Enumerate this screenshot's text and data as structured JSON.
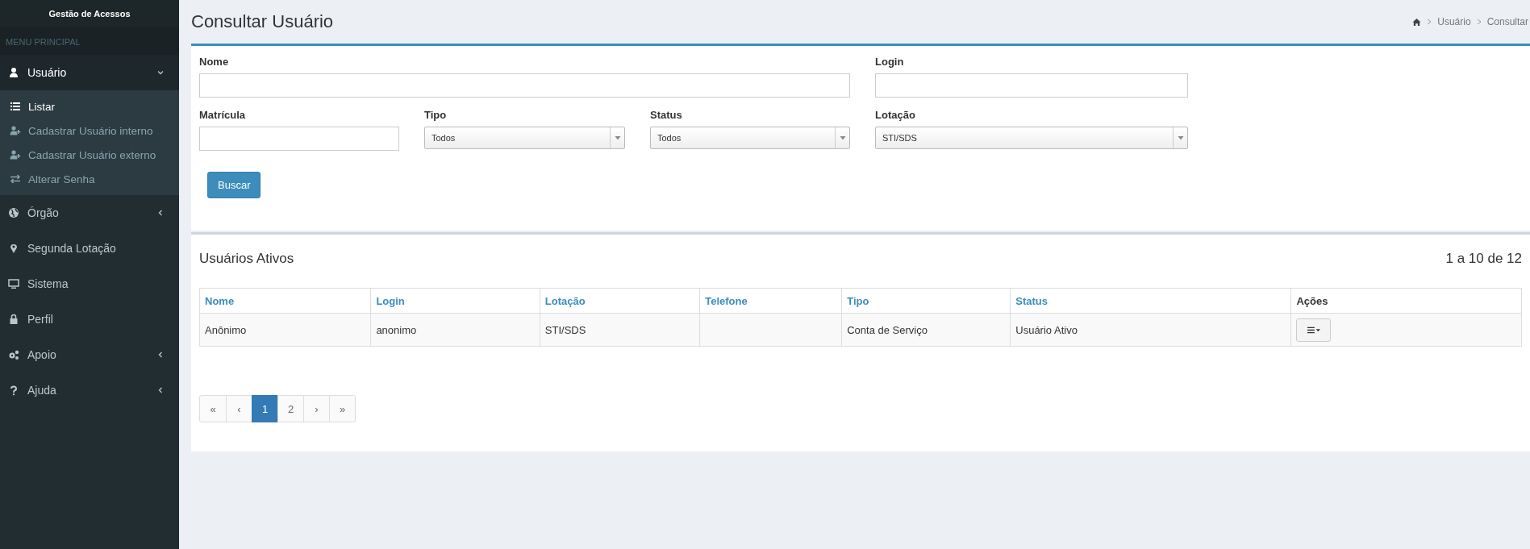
{
  "sidebar": {
    "title": "Gestão de Acessos",
    "section": "MENU PRINCIPAL",
    "items": [
      {
        "label": "Usuário",
        "expanded": true,
        "children": [
          {
            "label": "Listar",
            "selected": true
          },
          {
            "label": "Cadastrar Usuário interno",
            "selected": false
          },
          {
            "label": "Cadastrar Usuário externo",
            "selected": false
          },
          {
            "label": "Alterar Senha",
            "selected": false
          }
        ]
      },
      {
        "label": "Órgão",
        "expanded": false
      },
      {
        "label": "Segunda Lotação"
      },
      {
        "label": "Sistema"
      },
      {
        "label": "Perfil"
      },
      {
        "label": "Apoio",
        "expanded": false
      },
      {
        "label": "Ajuda",
        "expanded": false
      }
    ]
  },
  "page": {
    "title": "Consultar Usuário",
    "breadcrumb": [
      "Usuário",
      "Consultar"
    ]
  },
  "form": {
    "fields": [
      {
        "label": "Nome",
        "kind": "text"
      },
      {
        "label": "Login",
        "kind": "text"
      },
      {
        "label": "Matrícula",
        "kind": "text"
      },
      {
        "label": "Tipo",
        "kind": "select",
        "value": "Todos"
      },
      {
        "label": "Status",
        "kind": "select",
        "value": "Todos"
      },
      {
        "label": "Lotação",
        "kind": "select",
        "value": "STI/SDS"
      }
    ],
    "button": "Buscar"
  },
  "results": {
    "title": "Usuários Ativos",
    "count": "1 a 10 de 12",
    "table": {
      "columns": [
        "Nome",
        "Login",
        "Lotação",
        "Telefone",
        "Tipo",
        "Status",
        "Ações"
      ],
      "rows": [
        [
          "Anônimo",
          "anonimo",
          "STI/SDS",
          "",
          "Conta de Serviço",
          "Usuário Ativo"
        ]
      ]
    },
    "pagination": [
      {
        "label": "«",
        "selected": false
      },
      {
        "label": "‹",
        "selected": false
      },
      {
        "label": "1",
        "selected": true
      },
      {
        "label": "2",
        "selected": false
      },
      {
        "label": "›",
        "selected": false
      },
      {
        "label": "»",
        "selected": false
      }
    ]
  }
}
